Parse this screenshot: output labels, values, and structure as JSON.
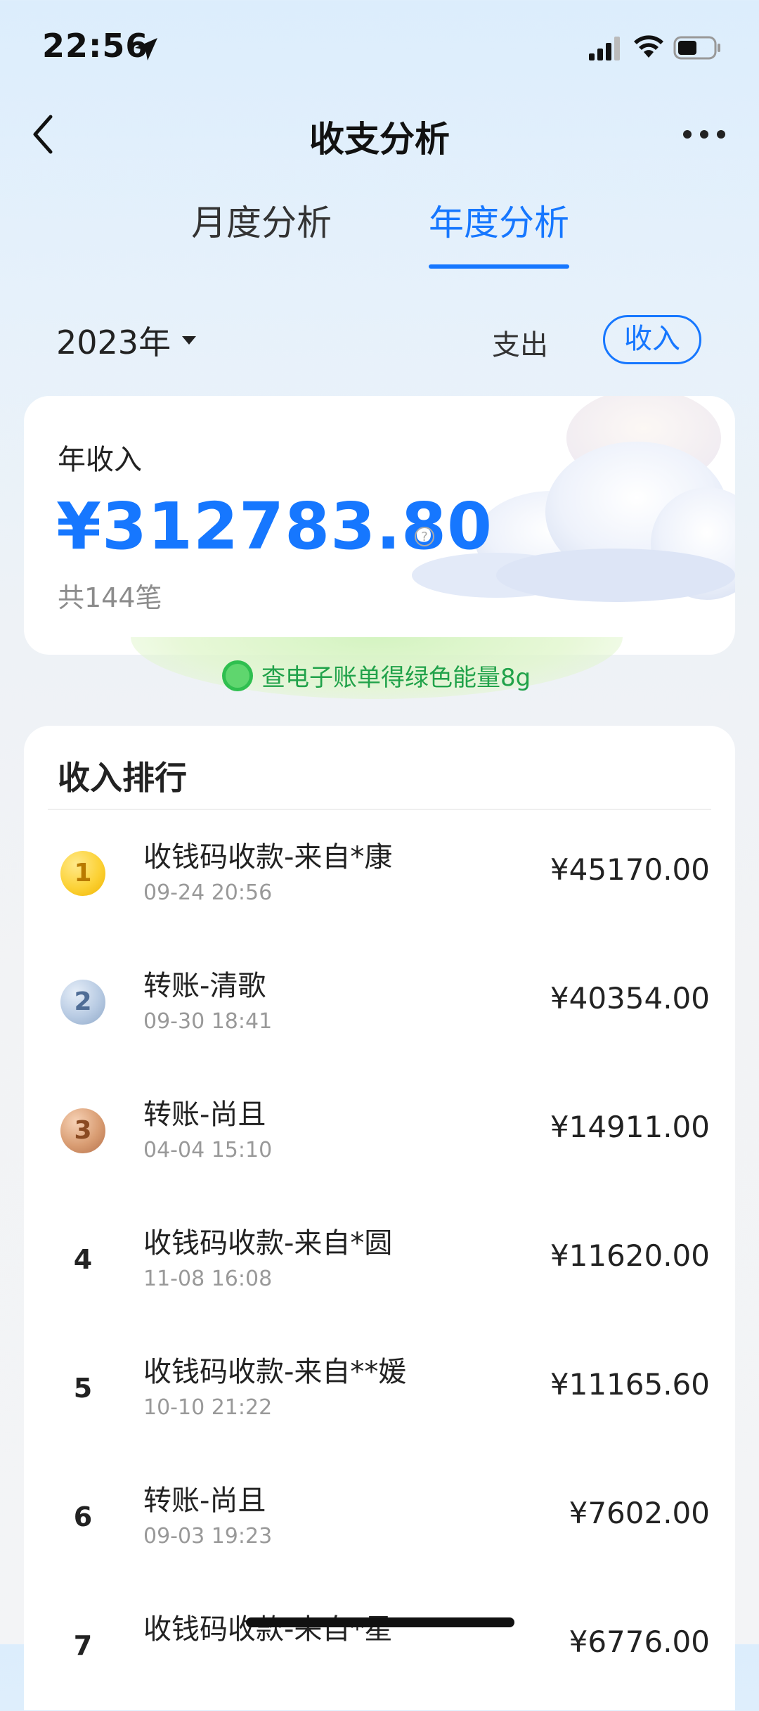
{
  "status_bar": {
    "time": "22:56",
    "icons": [
      "location-arrow-icon",
      "cellular-signal-icon",
      "wifi-icon",
      "battery-icon"
    ]
  },
  "nav": {
    "title": "收支分析",
    "icons": [
      "back-chevron-icon",
      "more-dots-icon"
    ]
  },
  "tabs": [
    {
      "label": "月度分析",
      "active": false
    },
    {
      "label": "年度分析",
      "active": true
    }
  ],
  "filter": {
    "year": "2023年",
    "expense_label": "支出",
    "income_label": "收入",
    "selected": "收入"
  },
  "summary": {
    "label": "年收入",
    "amount": "¥312783.80",
    "count": "共144笔"
  },
  "energy_banner": {
    "badge": "能量",
    "text": "查电子账单得绿色能量8g"
  },
  "ranking": {
    "title": "收入排行",
    "items": [
      {
        "rank": "1",
        "name": "收钱码收款-来自*康",
        "time": "09-24 20:56",
        "amount": "¥45170.00"
      },
      {
        "rank": "2",
        "name": "转账-清歌",
        "time": "09-30 18:41",
        "amount": "¥40354.00"
      },
      {
        "rank": "3",
        "name": "转账-尚且",
        "time": "04-04 15:10",
        "amount": "¥14911.00"
      },
      {
        "rank": "4",
        "name": "收钱码收款-来自*圆",
        "time": "11-08 16:08",
        "amount": "¥11620.00"
      },
      {
        "rank": "5",
        "name": "收钱码收款-来自**媛",
        "time": "10-10 21:22",
        "amount": "¥11165.60"
      },
      {
        "rank": "6",
        "name": "转账-尚且",
        "time": "09-03 19:23",
        "amount": "¥7602.00"
      },
      {
        "rank": "7",
        "name": "收钱码收款-来自*星",
        "time": "",
        "amount": "¥6776.00"
      }
    ]
  },
  "colors": {
    "accent": "#1677ff",
    "energy_green": "#21a24a",
    "gold": "#fcd237",
    "silver": "#b8cbe3",
    "bronze": "#d99d73"
  }
}
